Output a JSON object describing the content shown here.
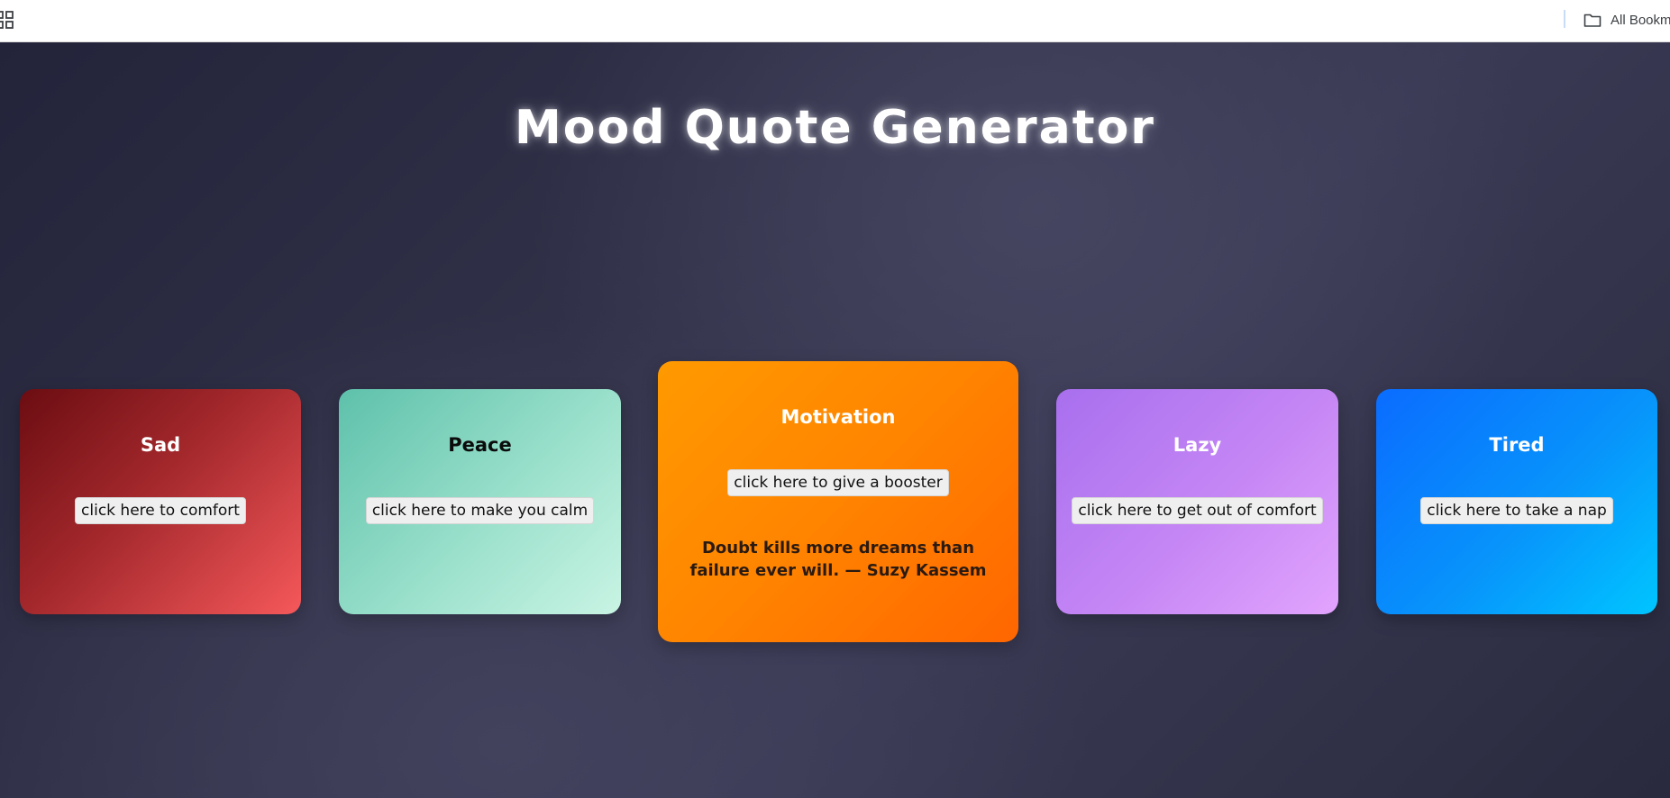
{
  "bookmarks_bar": {
    "apps_icon": "apps-grid-icon",
    "folder_icon": "folder-icon",
    "all_bookmarks_label": "All Bookm"
  },
  "page": {
    "title": "Mood Quote Generator"
  },
  "cards": [
    {
      "title": "Sad",
      "button": "click here to comfort",
      "colors": [
        "#6b0d12",
        "#f5585a"
      ]
    },
    {
      "title": "Peace",
      "button": "click here to make you calm",
      "colors": [
        "#5ec1ab",
        "#c9f4e4"
      ]
    },
    {
      "title": "Motivation",
      "button": "click here to give a booster",
      "quote": "Doubt kills more dreams than failure ever will. — Suzy Kassem",
      "colors": [
        "#ff9a00",
        "#ff6600"
      ]
    },
    {
      "title": "Lazy",
      "button": "click here to get out of comfort",
      "colors": [
        "#a86fee",
        "#e2a4fd"
      ]
    },
    {
      "title": "Tired",
      "button": "click here to take a nap",
      "colors": [
        "#0a6cff",
        "#00c5ff"
      ]
    }
  ],
  "theme": {
    "background": "#2b2b3d",
    "title_color": "#ffffff",
    "button_background": "#efefef"
  }
}
